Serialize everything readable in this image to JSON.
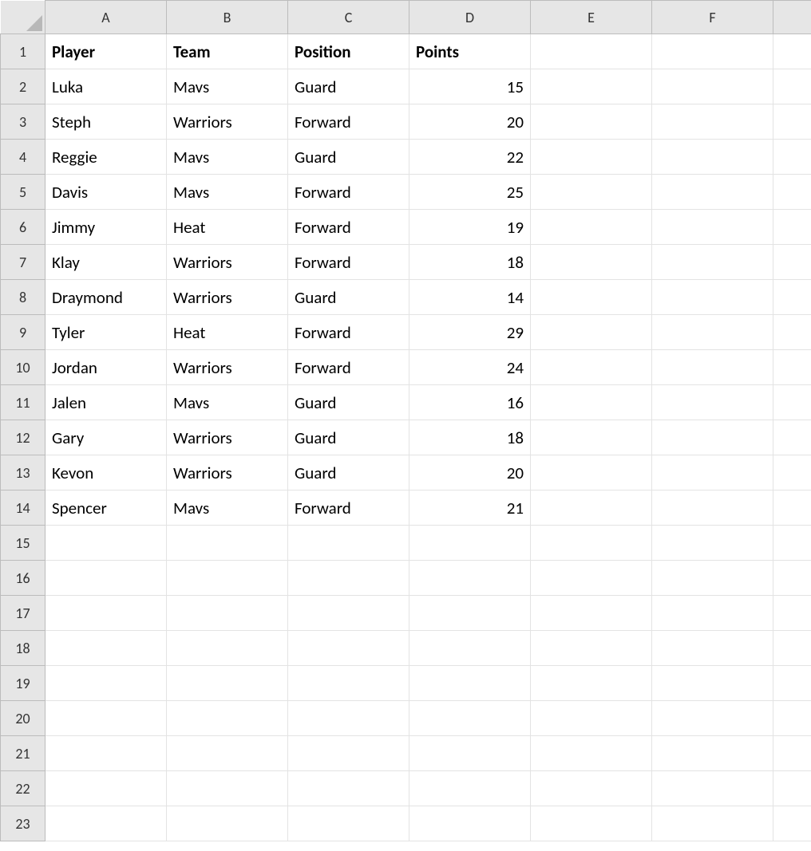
{
  "columns_letters": [
    "A",
    "B",
    "C",
    "D",
    "E",
    "F"
  ],
  "row_numbers": [
    1,
    2,
    3,
    4,
    5,
    6,
    7,
    8,
    9,
    10,
    11,
    12,
    13,
    14,
    15,
    16,
    17,
    18,
    19,
    20,
    21,
    22,
    23
  ],
  "header_row": [
    "Player",
    "Team",
    "Position",
    "Points",
    "",
    ""
  ],
  "data_rows": [
    [
      "Luka",
      "Mavs",
      "Guard",
      "15",
      "",
      ""
    ],
    [
      "Steph",
      "Warriors",
      "Forward",
      "20",
      "",
      ""
    ],
    [
      "Reggie",
      "Mavs",
      "Guard",
      "22",
      "",
      ""
    ],
    [
      "Davis",
      "Mavs",
      "Forward",
      "25",
      "",
      ""
    ],
    [
      "Jimmy",
      "Heat",
      "Forward",
      "19",
      "",
      ""
    ],
    [
      "Klay",
      "Warriors",
      "Forward",
      "18",
      "",
      ""
    ],
    [
      "Draymond",
      "Warriors",
      "Guard",
      "14",
      "",
      ""
    ],
    [
      "Tyler",
      "Heat",
      "Forward",
      "29",
      "",
      ""
    ],
    [
      "Jordan",
      "Warriors",
      "Forward",
      "24",
      "",
      ""
    ],
    [
      "Jalen",
      "Mavs",
      "Guard",
      "16",
      "",
      ""
    ],
    [
      "Gary",
      "Warriors",
      "Guard",
      "18",
      "",
      ""
    ],
    [
      "Kevon",
      "Warriors",
      "Guard",
      "20",
      "",
      ""
    ],
    [
      "Spencer",
      "Mavs",
      "Forward",
      "21",
      "",
      ""
    ]
  ],
  "numeric_columns": [
    3
  ],
  "blank_rows_after": 9
}
